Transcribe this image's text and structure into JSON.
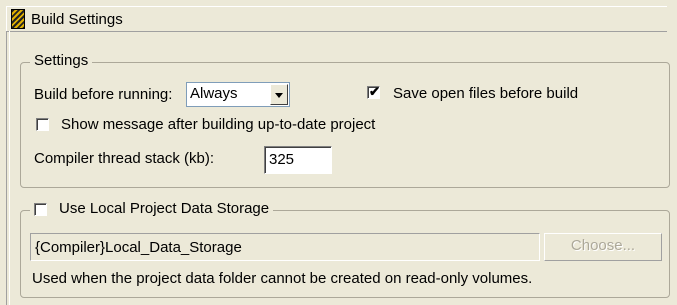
{
  "window": {
    "title": "Build Settings",
    "icon": "build-settings-icon"
  },
  "settings_group": {
    "legend": "Settings",
    "build_before_running_label": "Build before running:",
    "build_before_running_value": "Always",
    "save_open_files_label": "Save open files before build",
    "save_open_files_checked": true,
    "show_message_label": "Show message after building up-to-date project",
    "show_message_checked": false,
    "thread_stack_label": "Compiler thread stack (kb):",
    "thread_stack_value": "325"
  },
  "local_storage_group": {
    "legend": "Use Local Project Data Storage",
    "enabled": false,
    "path_value": "{Compiler}Local_Data_Storage",
    "choose_button": "Choose...",
    "note": "Used when the project data folder cannot be created on read-only volumes."
  },
  "colors": {
    "background": "#ece9d8",
    "group_border": "#aca899",
    "disabled_text": "#aca899"
  }
}
